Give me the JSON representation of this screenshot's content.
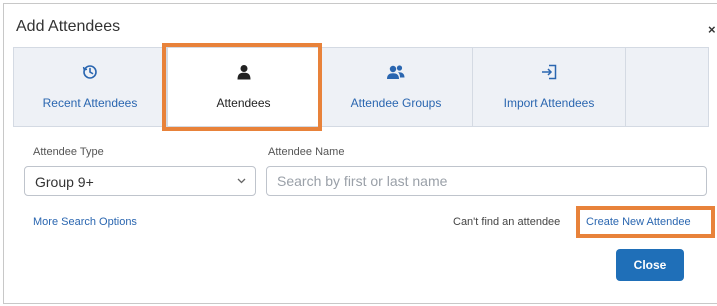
{
  "dialog": {
    "title": "Add Attendees",
    "close_glyph": "×"
  },
  "tabs": [
    {
      "label": "Recent Attendees",
      "icon": "history-icon"
    },
    {
      "label": "Attendees",
      "icon": "person-icon",
      "selected": true
    },
    {
      "label": "Attendee Groups",
      "icon": "group-icon"
    },
    {
      "label": "Import Attendees",
      "icon": "import-icon"
    }
  ],
  "form": {
    "type_label": "Attendee Type",
    "type_value": "Group 9+",
    "name_label": "Attendee Name",
    "name_placeholder": "Search by first or last name"
  },
  "footer": {
    "more_options": "More Search Options",
    "cant_find": "Can't find an attendee",
    "create_new": "Create New Attendee",
    "close_button": "Close"
  },
  "colors": {
    "accent": "#2a66b0",
    "button": "#1f6fb8",
    "highlight": "#e8823a",
    "tab_bg": "#eef1f6"
  }
}
